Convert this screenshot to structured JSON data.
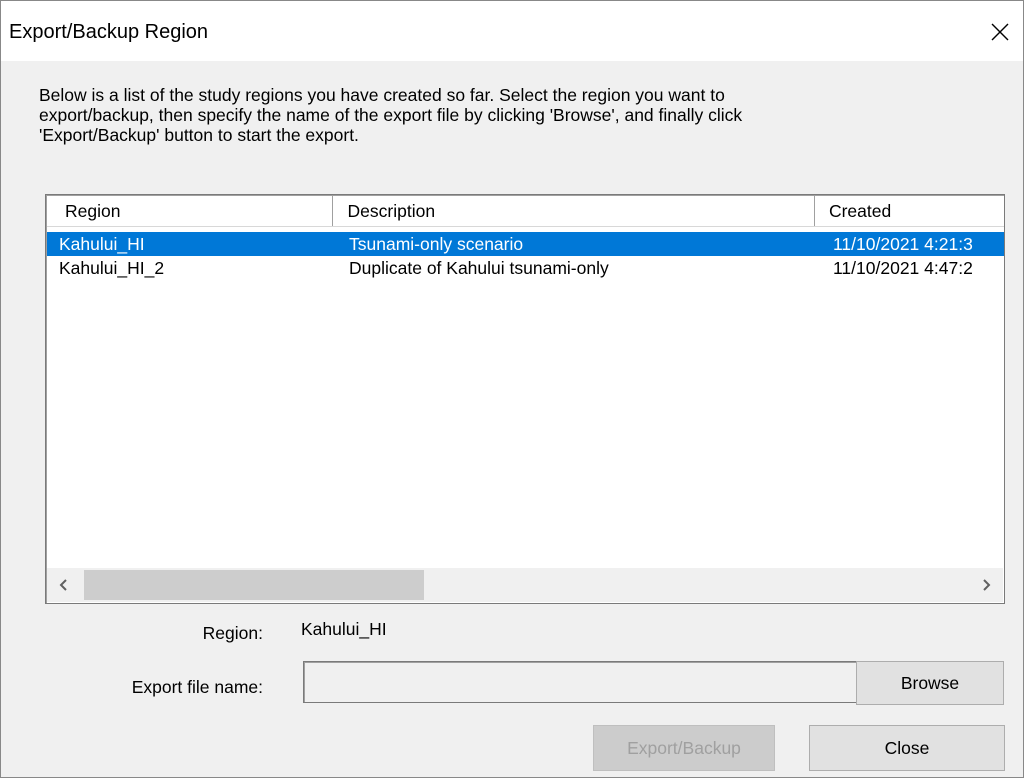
{
  "window": {
    "title": "Export/Backup Region"
  },
  "instructions": {
    "line1": "Below is a list of the study regions you have created so far.  Select the region you want to",
    "line2": "export/backup, then specify the name of the export file by clicking 'Browse', and finally click",
    "line3": "'Export/Backup' button to start the export."
  },
  "region_list": {
    "columns": [
      "Region",
      "Description",
      "Created"
    ],
    "rows": [
      {
        "region": "Kahului_HI",
        "description": "Tsunami-only scenario",
        "created": "11/10/2021 4:21:3",
        "selected": true
      },
      {
        "region": "Kahului_HI_2",
        "description": "Duplicate of Kahului tsunami-only",
        "created": "11/10/2021 4:47:2",
        "selected": false
      }
    ]
  },
  "form": {
    "region_label": "Region:",
    "region_value": "Kahului_HI",
    "export_label": "Export file name:",
    "export_value": ""
  },
  "buttons": {
    "browse": "Browse",
    "export": "Export/Backup",
    "close": "Close"
  },
  "icons": {
    "close": "close-icon",
    "scroll_left": "chevron-left-icon",
    "scroll_right": "chevron-right-icon"
  },
  "colors": {
    "selection": "#0078d7",
    "selection_text": "#ffffff",
    "disabled_text": "#a0a0a0"
  }
}
